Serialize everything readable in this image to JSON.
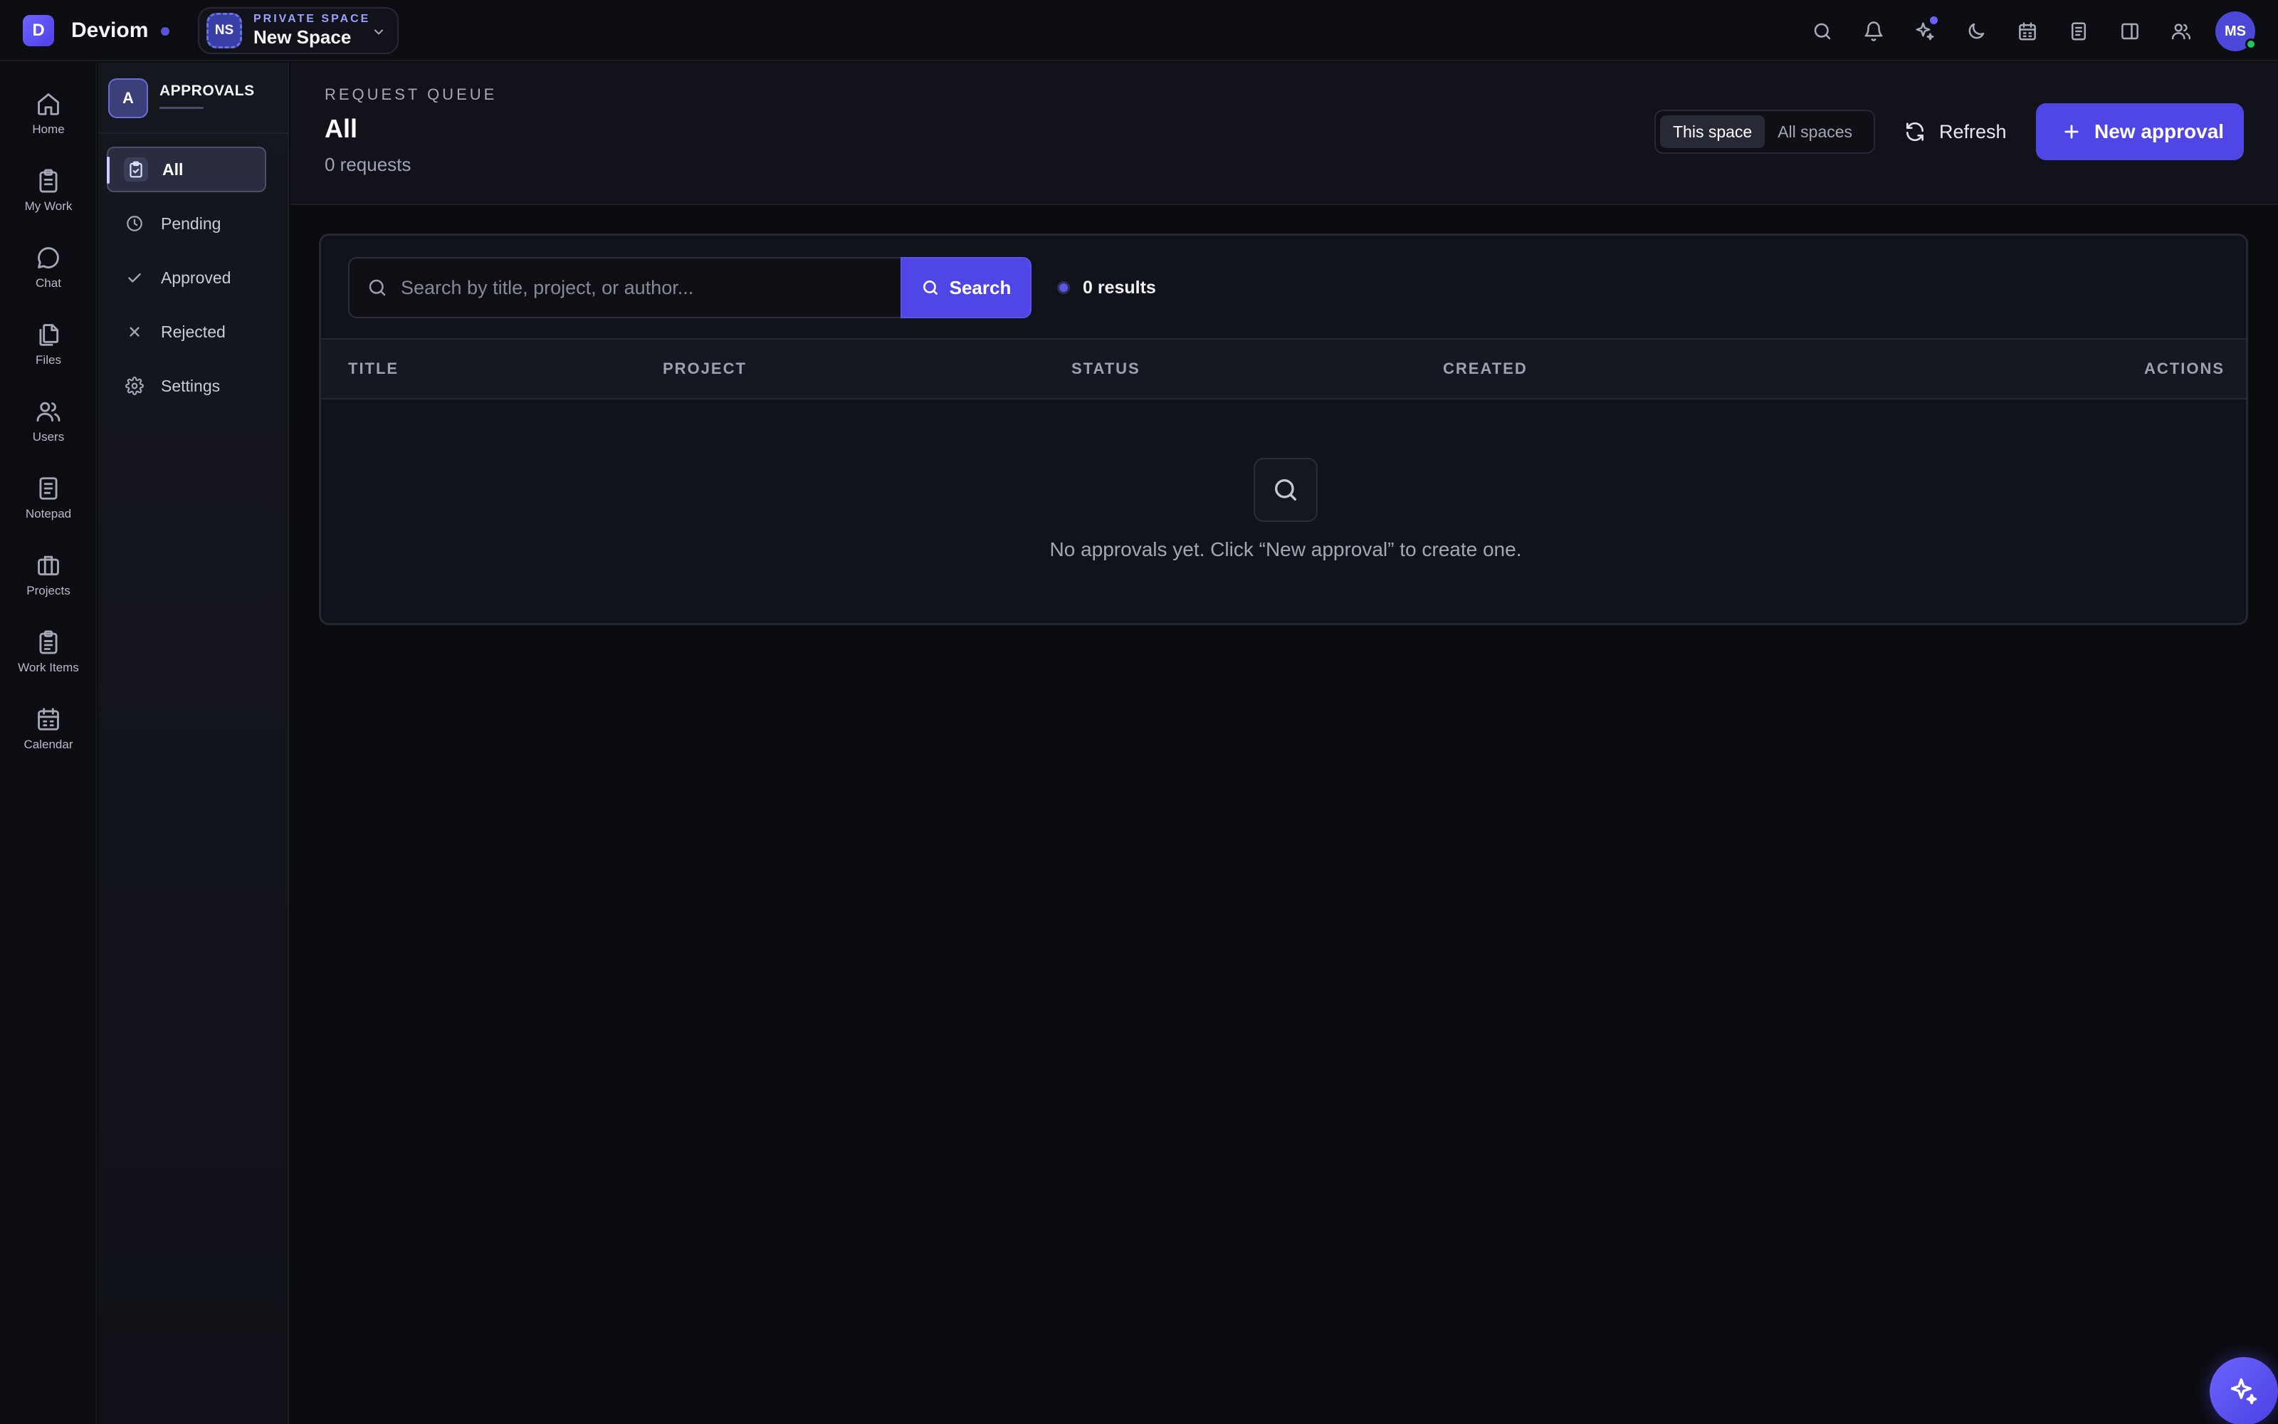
{
  "app": {
    "logo_letter": "D",
    "name": "Deviom"
  },
  "space": {
    "avatar": "NS",
    "label": "PRIVATE SPACE",
    "name": "New Space"
  },
  "topbar": {
    "icons": [
      "search-icon",
      "bell-icon",
      "sparkle-icon",
      "moon-icon",
      "calendar-icon",
      "notepad-icon",
      "panel-icon",
      "people-icon"
    ],
    "user_initials": "MS",
    "accent": "#4f46e5"
  },
  "rail": {
    "items": [
      {
        "label": "Home",
        "icon": "home-icon"
      },
      {
        "label": "My Work",
        "icon": "clipboard-icon"
      },
      {
        "label": "Chat",
        "icon": "chat-icon"
      },
      {
        "label": "Files",
        "icon": "files-icon"
      },
      {
        "label": "Users",
        "icon": "users-icon"
      },
      {
        "label": "Notepad",
        "icon": "notepad-icon"
      },
      {
        "label": "Projects",
        "icon": "briefcase-icon"
      },
      {
        "label": "Work Items",
        "icon": "clipboard-list-icon"
      },
      {
        "label": "Calendar",
        "icon": "calendar-icon"
      }
    ]
  },
  "subnav": {
    "badge": "A",
    "title": "APPROVALS",
    "items": [
      {
        "label": "All",
        "icon": "clipboard-check-icon",
        "active": true
      },
      {
        "label": "Pending",
        "icon": "clock-icon"
      },
      {
        "label": "Approved",
        "icon": "check-icon"
      },
      {
        "label": "Rejected",
        "icon": "x-icon"
      },
      {
        "label": "Settings",
        "icon": "gear-icon"
      }
    ]
  },
  "header": {
    "kicker": "REQUEST QUEUE",
    "title": "All",
    "count": "0 requests",
    "scope_options": [
      "This space",
      "All spaces"
    ],
    "scope_selected": "This space",
    "refresh_label": "Refresh",
    "new_label": "New approval"
  },
  "search": {
    "placeholder": "Search by title, project, or author...",
    "button_label": "Search",
    "results_label": "0 results"
  },
  "table": {
    "columns": [
      "TITLE",
      "PROJECT",
      "STATUS",
      "CREATED",
      "ACTIONS"
    ]
  },
  "empty": {
    "message": "No approvals yet. Click “New approval” to create one."
  }
}
